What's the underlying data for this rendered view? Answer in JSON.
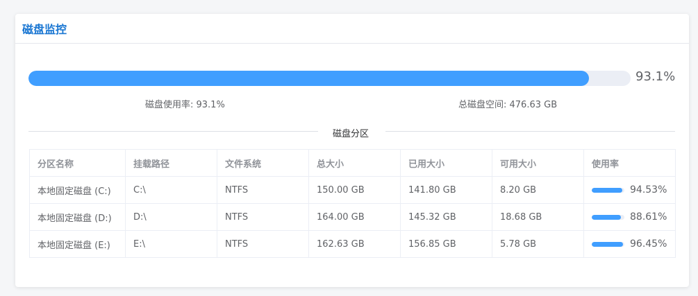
{
  "card": {
    "title": "磁盘监控"
  },
  "overall": {
    "percent": 93.1,
    "percent_label": "93.1%",
    "usage_text": "磁盘使用率: 93.1%",
    "total_text": "总磁盘空间: 476.63 GB"
  },
  "divider": {
    "label": "磁盘分区"
  },
  "table": {
    "headers": [
      "分区名称",
      "挂载路径",
      "文件系统",
      "总大小",
      "已用大小",
      "可用大小",
      "使用率"
    ],
    "rows": [
      {
        "name": "本地固定磁盘 (C:)",
        "path": "C:\\",
        "fs": "NTFS",
        "total": "150.00 GB",
        "used": "141.80 GB",
        "free": "8.20 GB",
        "usage_label": "94.53%",
        "usage": 94.53
      },
      {
        "name": "本地固定磁盘 (D:)",
        "path": "D:\\",
        "fs": "NTFS",
        "total": "164.00 GB",
        "used": "145.32 GB",
        "free": "18.68 GB",
        "usage_label": "88.61%",
        "usage": 88.61
      },
      {
        "name": "本地固定磁盘 (E:)",
        "path": "E:\\",
        "fs": "NTFS",
        "total": "162.63 GB",
        "used": "156.85 GB",
        "free": "5.78 GB",
        "usage_label": "96.45%",
        "usage": 96.45
      }
    ]
  },
  "colors": {
    "accent": "#409eff",
    "title": "#1976d2",
    "track": "#ebeef5"
  }
}
